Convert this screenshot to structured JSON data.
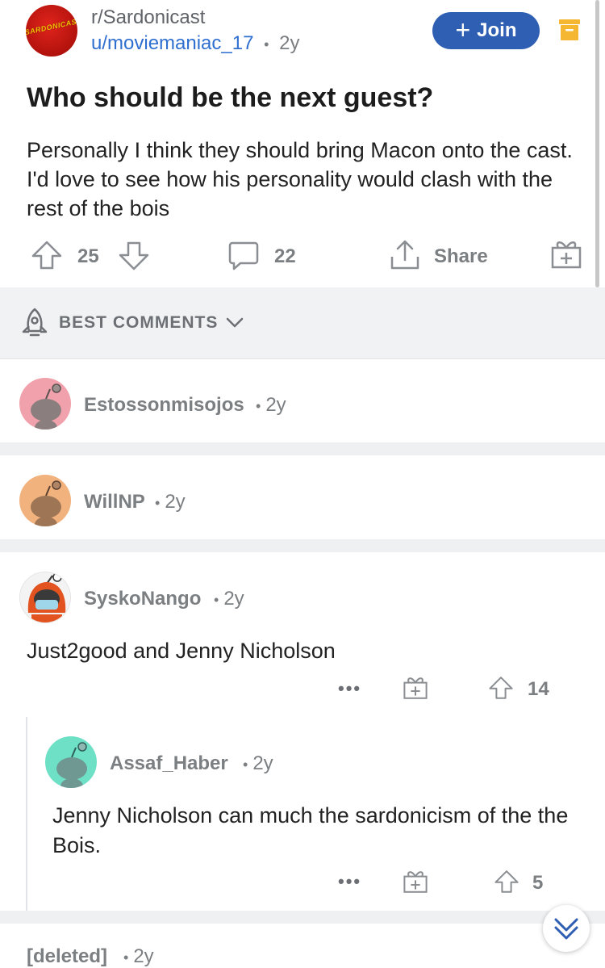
{
  "post": {
    "subreddit": "r/Sardonicast",
    "subreddit_logo_text": "SARDONICAST",
    "author": "u/moviemaniac_17",
    "age": "2y",
    "separator": "•",
    "join_label": "Join",
    "title": "Who should be the next guest?",
    "body": "Personally I think they should bring Macon onto the cast. I'd love to see how his personality would clash with the rest of the bois",
    "upvotes": "25",
    "comments": "22",
    "share_label": "Share"
  },
  "sort": {
    "label": "BEST COMMENTS"
  },
  "comments": [
    {
      "author": "Estossonmisojos",
      "age": "2y",
      "avatar_color": "#f0a1ab"
    },
    {
      "author": "WillNP",
      "age": "2y",
      "avatar_color": "#f2b27e"
    },
    {
      "author": "SyskoNango",
      "age": "2y",
      "body": "Just2good and Jenny Nicholson",
      "votes": "14",
      "more": "•••"
    },
    {
      "author": "Assaf_Haber",
      "age": "2y",
      "body": "Jenny Nicholson can much the sardonicism of the the Bois.",
      "votes": "5",
      "more": "•••",
      "avatar_color": "#6ee0c6"
    },
    {
      "author": "[deleted]",
      "age": "2y"
    }
  ],
  "colors": {
    "accent": "#2f5fb3",
    "link": "#2f6fd0",
    "muted": "#7b7f82",
    "archive": "#f5b731"
  }
}
